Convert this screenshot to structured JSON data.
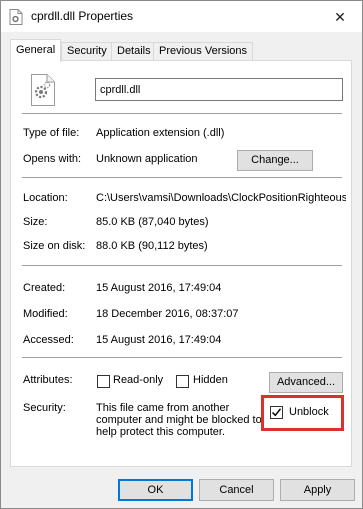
{
  "window": {
    "title": "cprdll.dll Properties",
    "close_glyph": "✕"
  },
  "tabs": [
    {
      "label": "General",
      "active": true
    },
    {
      "label": "Security",
      "active": false
    },
    {
      "label": "Details",
      "active": false
    },
    {
      "label": "Previous Versions",
      "active": false
    }
  ],
  "file": {
    "name": "cprdll.dll",
    "icon": "dll-file-gear-icon"
  },
  "type_section": {
    "type_label": "Type of file:",
    "type_value": "Application extension (.dll)",
    "opens_label": "Opens with:",
    "opens_value": "Unknown application",
    "change_button": "Change..."
  },
  "location_section": {
    "location_label": "Location:",
    "location_value": "C:\\Users\\vamsi\\Downloads\\ClockPositionRighteous",
    "size_label": "Size:",
    "size_value": "85.0 KB (87,040 bytes)",
    "size_on_disk_label": "Size on disk:",
    "size_on_disk_value": "88.0 KB (90,112 bytes)"
  },
  "dates_section": {
    "created_label": "Created:",
    "created_value": "15 August 2016, 17:49:04",
    "modified_label": "Modified:",
    "modified_value": "18 December 2016, 08:37:07",
    "accessed_label": "Accessed:",
    "accessed_value": "15 August 2016, 17:49:04"
  },
  "attributes_section": {
    "attributes_label": "Attributes:",
    "readonly_label": "Read-only",
    "readonly_checked": false,
    "hidden_label": "Hidden",
    "hidden_checked": false,
    "advanced_button": "Advanced...",
    "security_label": "Security:",
    "security_lines": [
      "This file came from another",
      "computer and might be blocked to",
      "help protect this computer."
    ],
    "unblock_label": "Unblock",
    "unblock_checked": true,
    "highlight_color": "#d9322b"
  },
  "footer": {
    "ok": "OK",
    "cancel": "Cancel",
    "apply": "Apply"
  }
}
